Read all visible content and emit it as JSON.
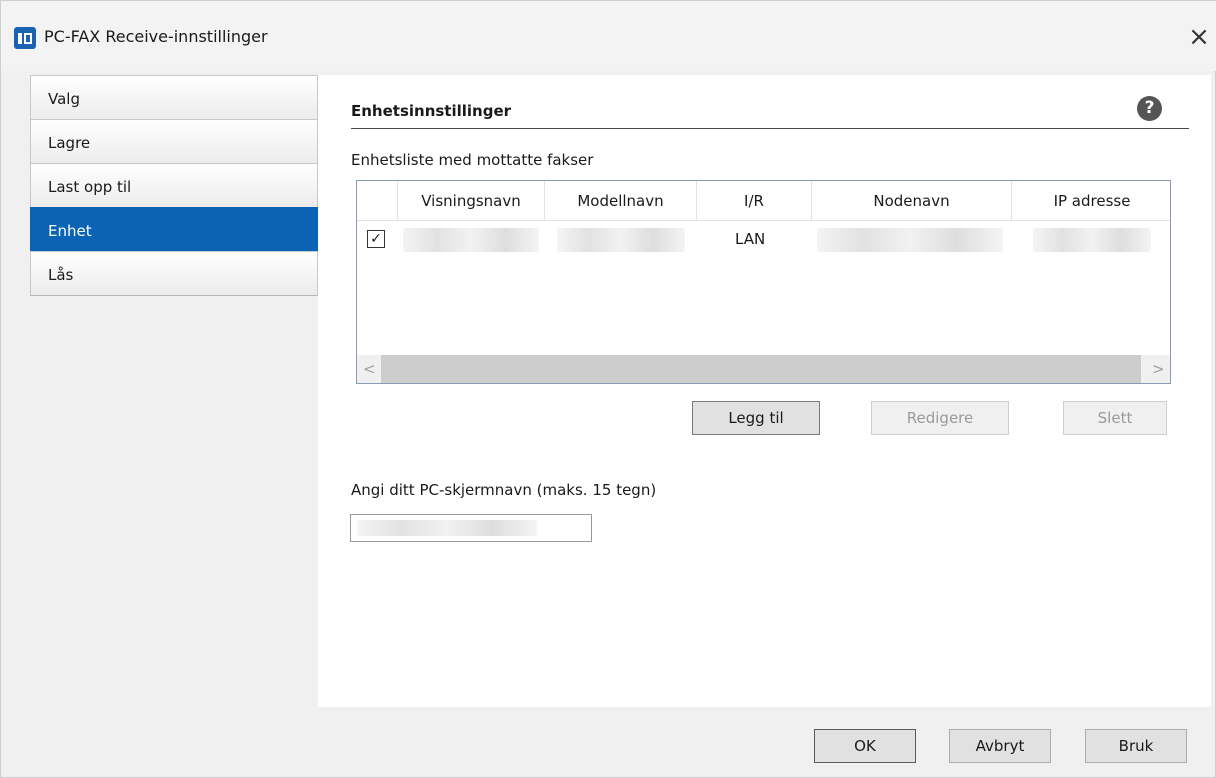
{
  "window": {
    "title": "PC-FAX Receive-innstillinger",
    "close_label": "×"
  },
  "nav": {
    "items": [
      {
        "label": "Valg"
      },
      {
        "label": "Lagre"
      },
      {
        "label": "Last opp til"
      },
      {
        "label": "Enhet",
        "active": true
      },
      {
        "label": "Lås"
      }
    ]
  },
  "panel": {
    "title": "Enhetsinnstillinger",
    "help_label": "?",
    "list_label": "Enhetsliste med mottatte fakser",
    "columns": [
      "Visningsnavn",
      "Modellnavn",
      "I/R",
      "Nodenavn",
      "IP adresse"
    ],
    "rows": [
      {
        "checked": true,
        "check_glyph": "✓",
        "visningsnavn": "",
        "modellnavn": "",
        "ir": "LAN",
        "nodenavn": "",
        "ip": ""
      }
    ],
    "scroll_left": "<",
    "scroll_right": ">",
    "buttons": {
      "add": "Legg til",
      "edit": "Redigere",
      "delete": "Slett"
    },
    "pc_name_label": "Angi ditt PC-skjermnavn (maks. 15 tegn)",
    "pc_name_value": ""
  },
  "footer": {
    "ok": "OK",
    "cancel": "Avbryt",
    "apply": "Bruk"
  },
  "colors": {
    "accent": "#0a63b4",
    "app_icon": "#1a62b2"
  }
}
